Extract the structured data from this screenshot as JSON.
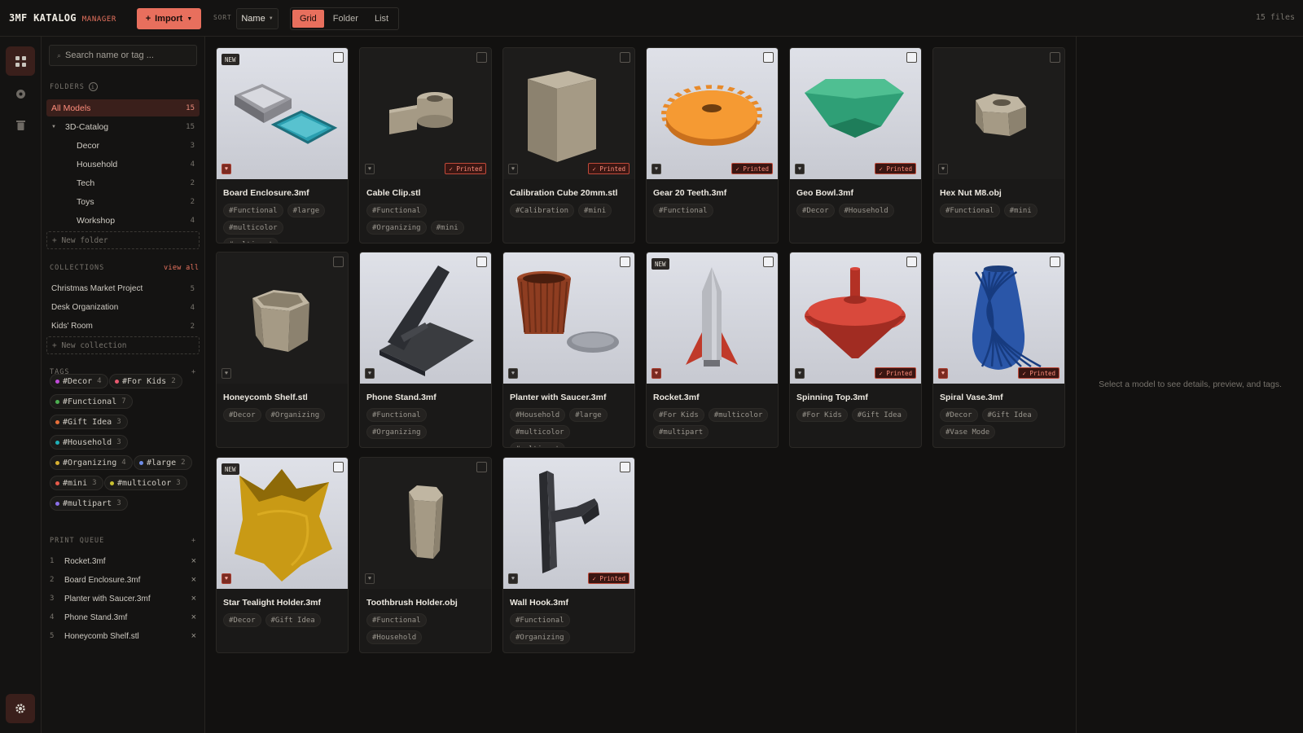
{
  "app": {
    "name": "3MF KATALOG",
    "subtitle": "MANAGER",
    "file_count": "15 files"
  },
  "toolbar": {
    "import_label": "Import",
    "sort_label": "SORT",
    "sort_value": "Name",
    "views": [
      {
        "label": "Grid",
        "active": true
      },
      {
        "label": "Folder",
        "active": false
      },
      {
        "label": "List",
        "active": false
      }
    ]
  },
  "search": {
    "placeholder": "Search name or tag ..."
  },
  "folders": {
    "heading": "FOLDERS",
    "all": {
      "label": "All Models",
      "count": "15"
    },
    "root": {
      "label": "3D-Catalog",
      "count": "15"
    },
    "children": [
      {
        "label": "Decor",
        "count": "3"
      },
      {
        "label": "Household",
        "count": "4"
      },
      {
        "label": "Tech",
        "count": "2"
      },
      {
        "label": "Toys",
        "count": "2"
      },
      {
        "label": "Workshop",
        "count": "4"
      }
    ],
    "new_label": "+ New folder"
  },
  "collections": {
    "heading": "COLLECTIONS",
    "view_all": "view all",
    "items": [
      {
        "label": "Christmas Market Project",
        "count": "5"
      },
      {
        "label": "Desk Organization",
        "count": "4"
      },
      {
        "label": "Kids' Room",
        "count": "2"
      }
    ],
    "new_label": "+ New collection"
  },
  "tags": {
    "heading": "TAGS",
    "add": "+",
    "items": [
      {
        "label": "#Decor",
        "count": "4",
        "color": "#c04ad8"
      },
      {
        "label": "#For Kids",
        "count": "2",
        "color": "#e85a6f"
      },
      {
        "label": "#Functional",
        "count": "7",
        "color": "#4caf50"
      },
      {
        "label": "#Gift Idea",
        "count": "3",
        "color": "#e86f3a"
      },
      {
        "label": "#Household",
        "count": "3",
        "color": "#1fb0b8"
      },
      {
        "label": "#Organizing",
        "count": "4",
        "color": "#d8b030"
      },
      {
        "label": "#large",
        "count": "2",
        "color": "#6f8de8"
      },
      {
        "label": "#mini",
        "count": "3",
        "color": "#e85a4a"
      },
      {
        "label": "#multicolor",
        "count": "3",
        "color": "#c8c030"
      },
      {
        "label": "#multipart",
        "count": "3",
        "color": "#8a6fe8"
      }
    ]
  },
  "queue": {
    "heading": "PRINT QUEUE",
    "add": "+",
    "items": [
      {
        "n": "1",
        "label": "Rocket.3mf"
      },
      {
        "n": "2",
        "label": "Board Enclosure.3mf"
      },
      {
        "n": "3",
        "label": "Planter with Saucer.3mf"
      },
      {
        "n": "4",
        "label": "Phone Stand.3mf"
      },
      {
        "n": "5",
        "label": "Honeycomb Shelf.stl"
      }
    ],
    "remove": "×"
  },
  "badges": {
    "new": "NEW",
    "printed": "✓ Printed"
  },
  "models": [
    {
      "name": "Board Enclosure.3mf",
      "tags": [
        "#Functional",
        "#large",
        "#multicolor",
        "#multipart"
      ],
      "new": true,
      "printed": false,
      "fav": true,
      "bg": "light",
      "shape": "enclosure"
    },
    {
      "name": "Cable Clip.stl",
      "tags": [
        "#Functional",
        "#Organizing",
        "#mini"
      ],
      "new": false,
      "printed": true,
      "fav": false,
      "bg": "dark",
      "shape": "clip"
    },
    {
      "name": "Calibration Cube 20mm.stl",
      "tags": [
        "#Calibration",
        "#mini"
      ],
      "new": false,
      "printed": true,
      "fav": false,
      "bg": "dark",
      "shape": "cube"
    },
    {
      "name": "Gear 20 Teeth.3mf",
      "tags": [
        "#Functional"
      ],
      "new": false,
      "printed": true,
      "fav": false,
      "bg": "light",
      "shape": "gear"
    },
    {
      "name": "Geo Bowl.3mf",
      "tags": [
        "#Decor",
        "#Household"
      ],
      "new": false,
      "printed": true,
      "fav": false,
      "bg": "light",
      "shape": "bowl"
    },
    {
      "name": "Hex Nut M8.obj",
      "tags": [
        "#Functional",
        "#mini"
      ],
      "new": false,
      "printed": false,
      "fav": false,
      "bg": "dark",
      "shape": "nut"
    },
    {
      "name": "Honeycomb Shelf.stl",
      "tags": [
        "#Decor",
        "#Organizing"
      ],
      "new": false,
      "printed": false,
      "fav": false,
      "bg": "dark",
      "shape": "hexcup"
    },
    {
      "name": "Phone Stand.3mf",
      "tags": [
        "#Functional",
        "#Organizing"
      ],
      "new": false,
      "printed": false,
      "fav": false,
      "bg": "light",
      "shape": "stand"
    },
    {
      "name": "Planter with Saucer.3mf",
      "tags": [
        "#Household",
        "#large",
        "#multicolor",
        "#multipart"
      ],
      "new": false,
      "printed": false,
      "fav": false,
      "bg": "light",
      "shape": "planter"
    },
    {
      "name": "Rocket.3mf",
      "tags": [
        "#For Kids",
        "#multicolor",
        "#multipart"
      ],
      "new": true,
      "printed": false,
      "fav": true,
      "bg": "light",
      "shape": "rocket"
    },
    {
      "name": "Spinning Top.3mf",
      "tags": [
        "#For Kids",
        "#Gift Idea"
      ],
      "new": false,
      "printed": true,
      "fav": false,
      "bg": "light",
      "shape": "top"
    },
    {
      "name": "Spiral Vase.3mf",
      "tags": [
        "#Decor",
        "#Gift Idea",
        "#Vase Mode"
      ],
      "new": false,
      "printed": true,
      "fav": true,
      "bg": "light",
      "shape": "vase"
    },
    {
      "name": "Star Tealight Holder.3mf",
      "tags": [
        "#Decor",
        "#Gift Idea"
      ],
      "new": true,
      "printed": false,
      "fav": true,
      "bg": "light",
      "shape": "star"
    },
    {
      "name": "Toothbrush Holder.obj",
      "tags": [
        "#Functional",
        "#Household"
      ],
      "new": false,
      "printed": false,
      "fav": false,
      "bg": "dark",
      "shape": "tooth"
    },
    {
      "name": "Wall Hook.3mf",
      "tags": [
        "#Functional",
        "#Organizing"
      ],
      "new": false,
      "printed": true,
      "fav": false,
      "bg": "light",
      "shape": "hook"
    }
  ],
  "detail": {
    "hint": "Select a model to see details, preview, and tags."
  },
  "colors": {
    "accent": "#e86f5d",
    "bg": "#121110",
    "panel": "#141312"
  }
}
